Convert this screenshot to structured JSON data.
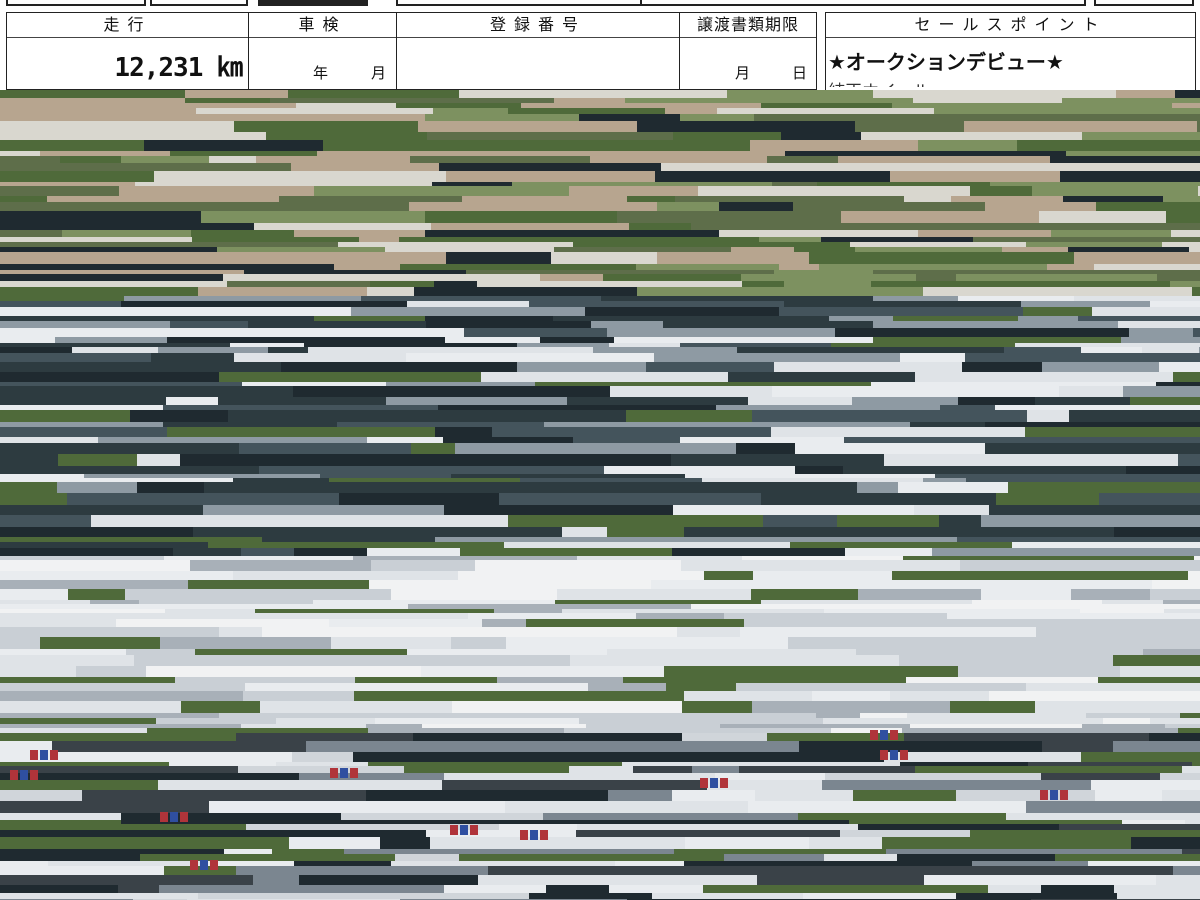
{
  "sheet": {
    "mileage": {
      "header": "走行",
      "value": "12,231 ㎞"
    },
    "inspection": {
      "header": "車検",
      "year_unit": "年",
      "month_unit": "月"
    },
    "registration": {
      "header": "登録番号",
      "value": ""
    },
    "transfer_deadline": {
      "header": "譲渡書類期限",
      "month_unit": "月",
      "day_unit": "日"
    },
    "sales_point": {
      "header": "セールスポイント",
      "line1": "★オークションデビュー★",
      "line2": "純正ホイール"
    }
  },
  "photo": {
    "description_colors": {
      "foliage": "#4f6a3a",
      "foliage_light": "#7d9160",
      "sky_white": "#e9ecef",
      "car_white": "#dfe3e7",
      "shadow": "#1f2a30",
      "dark_teal": "#2d3b40",
      "tan": "#b7a58f",
      "red_accent": "#b0343a",
      "blue_accent": "#2f4fa0"
    }
  }
}
